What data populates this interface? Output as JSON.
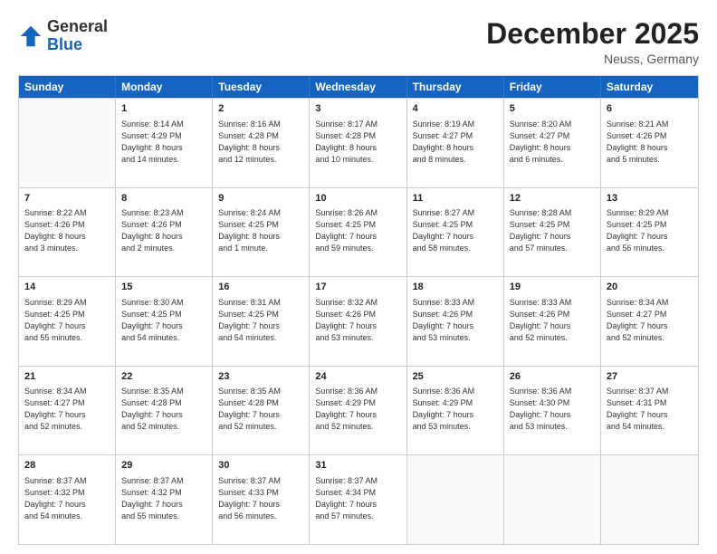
{
  "header": {
    "logo_general": "General",
    "logo_blue": "Blue",
    "month_title": "December 2025",
    "location": "Neuss, Germany"
  },
  "days_of_week": [
    "Sunday",
    "Monday",
    "Tuesday",
    "Wednesday",
    "Thursday",
    "Friday",
    "Saturday"
  ],
  "weeks": [
    [
      {
        "day": "",
        "info": ""
      },
      {
        "day": "1",
        "info": "Sunrise: 8:14 AM\nSunset: 4:29 PM\nDaylight: 8 hours\nand 14 minutes."
      },
      {
        "day": "2",
        "info": "Sunrise: 8:16 AM\nSunset: 4:28 PM\nDaylight: 8 hours\nand 12 minutes."
      },
      {
        "day": "3",
        "info": "Sunrise: 8:17 AM\nSunset: 4:28 PM\nDaylight: 8 hours\nand 10 minutes."
      },
      {
        "day": "4",
        "info": "Sunrise: 8:19 AM\nSunset: 4:27 PM\nDaylight: 8 hours\nand 8 minutes."
      },
      {
        "day": "5",
        "info": "Sunrise: 8:20 AM\nSunset: 4:27 PM\nDaylight: 8 hours\nand 6 minutes."
      },
      {
        "day": "6",
        "info": "Sunrise: 8:21 AM\nSunset: 4:26 PM\nDaylight: 8 hours\nand 5 minutes."
      }
    ],
    [
      {
        "day": "7",
        "info": "Sunrise: 8:22 AM\nSunset: 4:26 PM\nDaylight: 8 hours\nand 3 minutes."
      },
      {
        "day": "8",
        "info": "Sunrise: 8:23 AM\nSunset: 4:26 PM\nDaylight: 8 hours\nand 2 minutes."
      },
      {
        "day": "9",
        "info": "Sunrise: 8:24 AM\nSunset: 4:25 PM\nDaylight: 8 hours\nand 1 minute."
      },
      {
        "day": "10",
        "info": "Sunrise: 8:26 AM\nSunset: 4:25 PM\nDaylight: 7 hours\nand 59 minutes."
      },
      {
        "day": "11",
        "info": "Sunrise: 8:27 AM\nSunset: 4:25 PM\nDaylight: 7 hours\nand 58 minutes."
      },
      {
        "day": "12",
        "info": "Sunrise: 8:28 AM\nSunset: 4:25 PM\nDaylight: 7 hours\nand 57 minutes."
      },
      {
        "day": "13",
        "info": "Sunrise: 8:29 AM\nSunset: 4:25 PM\nDaylight: 7 hours\nand 56 minutes."
      }
    ],
    [
      {
        "day": "14",
        "info": "Sunrise: 8:29 AM\nSunset: 4:25 PM\nDaylight: 7 hours\nand 55 minutes."
      },
      {
        "day": "15",
        "info": "Sunrise: 8:30 AM\nSunset: 4:25 PM\nDaylight: 7 hours\nand 54 minutes."
      },
      {
        "day": "16",
        "info": "Sunrise: 8:31 AM\nSunset: 4:25 PM\nDaylight: 7 hours\nand 54 minutes."
      },
      {
        "day": "17",
        "info": "Sunrise: 8:32 AM\nSunset: 4:26 PM\nDaylight: 7 hours\nand 53 minutes."
      },
      {
        "day": "18",
        "info": "Sunrise: 8:33 AM\nSunset: 4:26 PM\nDaylight: 7 hours\nand 53 minutes."
      },
      {
        "day": "19",
        "info": "Sunrise: 8:33 AM\nSunset: 4:26 PM\nDaylight: 7 hours\nand 52 minutes."
      },
      {
        "day": "20",
        "info": "Sunrise: 8:34 AM\nSunset: 4:27 PM\nDaylight: 7 hours\nand 52 minutes."
      }
    ],
    [
      {
        "day": "21",
        "info": "Sunrise: 8:34 AM\nSunset: 4:27 PM\nDaylight: 7 hours\nand 52 minutes."
      },
      {
        "day": "22",
        "info": "Sunrise: 8:35 AM\nSunset: 4:28 PM\nDaylight: 7 hours\nand 52 minutes."
      },
      {
        "day": "23",
        "info": "Sunrise: 8:35 AM\nSunset: 4:28 PM\nDaylight: 7 hours\nand 52 minutes."
      },
      {
        "day": "24",
        "info": "Sunrise: 8:36 AM\nSunset: 4:29 PM\nDaylight: 7 hours\nand 52 minutes."
      },
      {
        "day": "25",
        "info": "Sunrise: 8:36 AM\nSunset: 4:29 PM\nDaylight: 7 hours\nand 53 minutes."
      },
      {
        "day": "26",
        "info": "Sunrise: 8:36 AM\nSunset: 4:30 PM\nDaylight: 7 hours\nand 53 minutes."
      },
      {
        "day": "27",
        "info": "Sunrise: 8:37 AM\nSunset: 4:31 PM\nDaylight: 7 hours\nand 54 minutes."
      }
    ],
    [
      {
        "day": "28",
        "info": "Sunrise: 8:37 AM\nSunset: 4:32 PM\nDaylight: 7 hours\nand 54 minutes."
      },
      {
        "day": "29",
        "info": "Sunrise: 8:37 AM\nSunset: 4:32 PM\nDaylight: 7 hours\nand 55 minutes."
      },
      {
        "day": "30",
        "info": "Sunrise: 8:37 AM\nSunset: 4:33 PM\nDaylight: 7 hours\nand 56 minutes."
      },
      {
        "day": "31",
        "info": "Sunrise: 8:37 AM\nSunset: 4:34 PM\nDaylight: 7 hours\nand 57 minutes."
      },
      {
        "day": "",
        "info": ""
      },
      {
        "day": "",
        "info": ""
      },
      {
        "day": "",
        "info": ""
      }
    ]
  ]
}
